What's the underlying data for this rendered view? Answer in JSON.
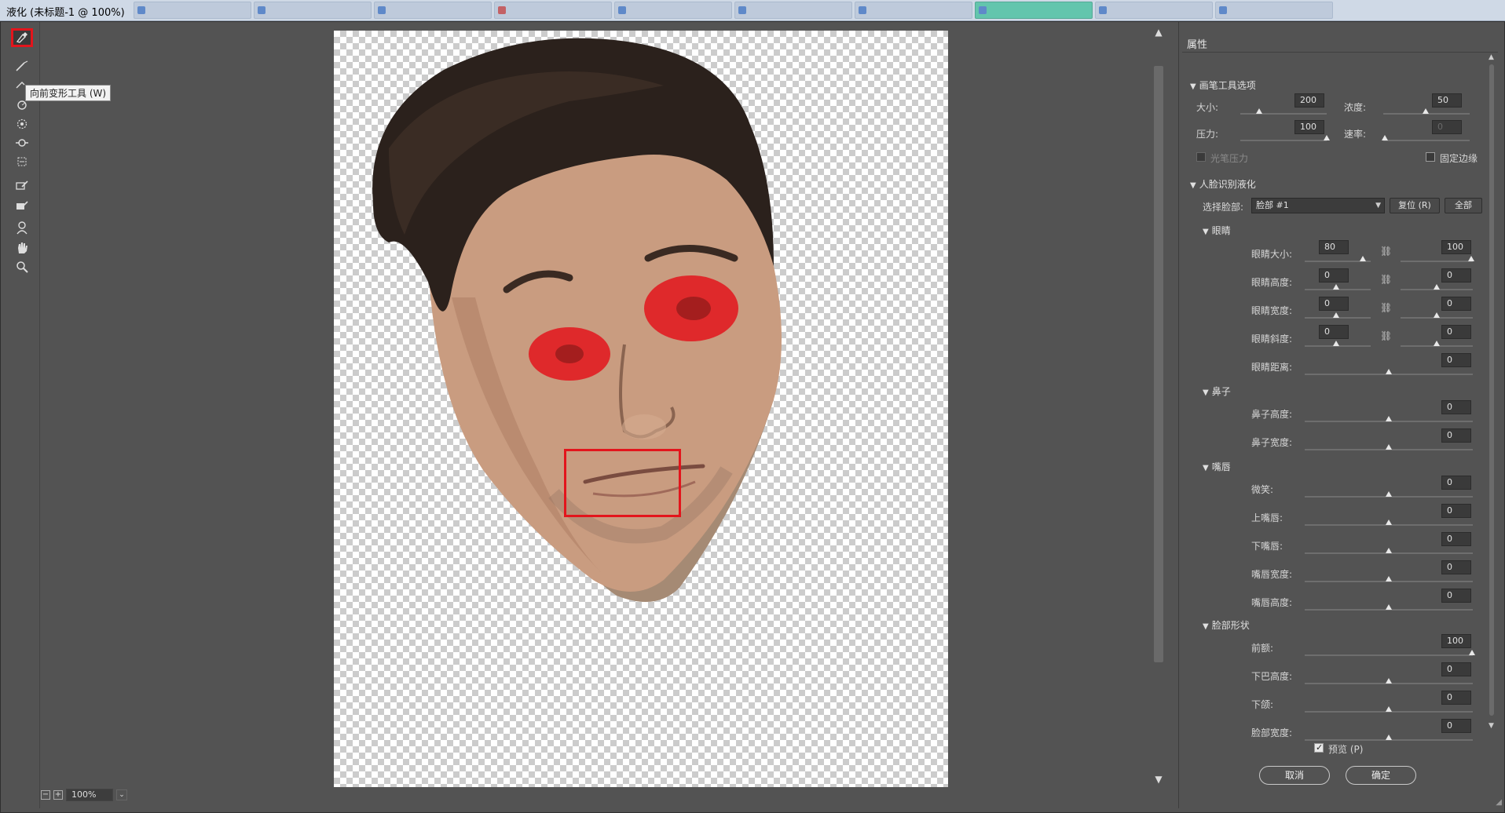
{
  "window": {
    "title": "液化 (未标题-1 @ 100%)"
  },
  "tools": {
    "tooltip": "向前变形工具 (W)",
    "items": [
      "forward-warp",
      "reconstruct",
      "smooth",
      "twirl",
      "pucker",
      "bloat",
      "push-left",
      "freeze-mask",
      "thaw-mask",
      "face",
      "hand",
      "zoom"
    ]
  },
  "status": {
    "zoom": "100%"
  },
  "panel": {
    "title": "属性",
    "brush": {
      "section": "画笔工具选项",
      "size_label": "大小:",
      "size_value": "200",
      "density_label": "浓度:",
      "density_value": "50",
      "pressure_label": "压力:",
      "pressure_value": "100",
      "rate_label": "速率:",
      "rate_value": "0",
      "stylus_label": "光笔压力",
      "pin_edges_label": "固定边缘"
    },
    "face": {
      "section": "人脸识别液化",
      "select_label": "选择脸部:",
      "select_value": "脸部 #1",
      "reset_label": "复位 (R)",
      "all_label": "全部",
      "eyes": {
        "section": "眼睛",
        "rows": [
          {
            "label": "眼睛大小:",
            "left": "80",
            "right": "100"
          },
          {
            "label": "眼睛高度:",
            "left": "0",
            "right": "0"
          },
          {
            "label": "眼睛宽度:",
            "left": "0",
            "right": "0"
          },
          {
            "label": "眼睛斜度:",
            "left": "0",
            "right": "0"
          }
        ],
        "distance_label": "眼睛距离:",
        "distance_value": "0"
      },
      "nose": {
        "section": "鼻子",
        "height_label": "鼻子高度:",
        "height_value": "0",
        "width_label": "鼻子宽度:",
        "width_value": "0"
      },
      "mouth": {
        "section": "嘴唇",
        "smile_label": "微笑:",
        "smile_value": "0",
        "upper_label": "上嘴唇:",
        "upper_value": "0",
        "lower_label": "下嘴唇:",
        "lower_value": "0",
        "width_label": "嘴唇宽度:",
        "width_value": "0",
        "height_label": "嘴唇高度:",
        "height_value": "0"
      },
      "shape": {
        "section": "脸部形状",
        "forehead_label": "前额:",
        "forehead_value": "100",
        "chin_height_label": "下巴高度:",
        "chin_height_value": "0",
        "jaw_label": "下颌:",
        "jaw_value": "0",
        "face_width_label": "脸部宽度:",
        "face_width_value": "0"
      }
    },
    "preview_label": "预览 (P)",
    "cancel_label": "取消",
    "ok_label": "确定"
  },
  "colors": {
    "highlight": "#e3151c",
    "panel_bg": "#535353"
  }
}
